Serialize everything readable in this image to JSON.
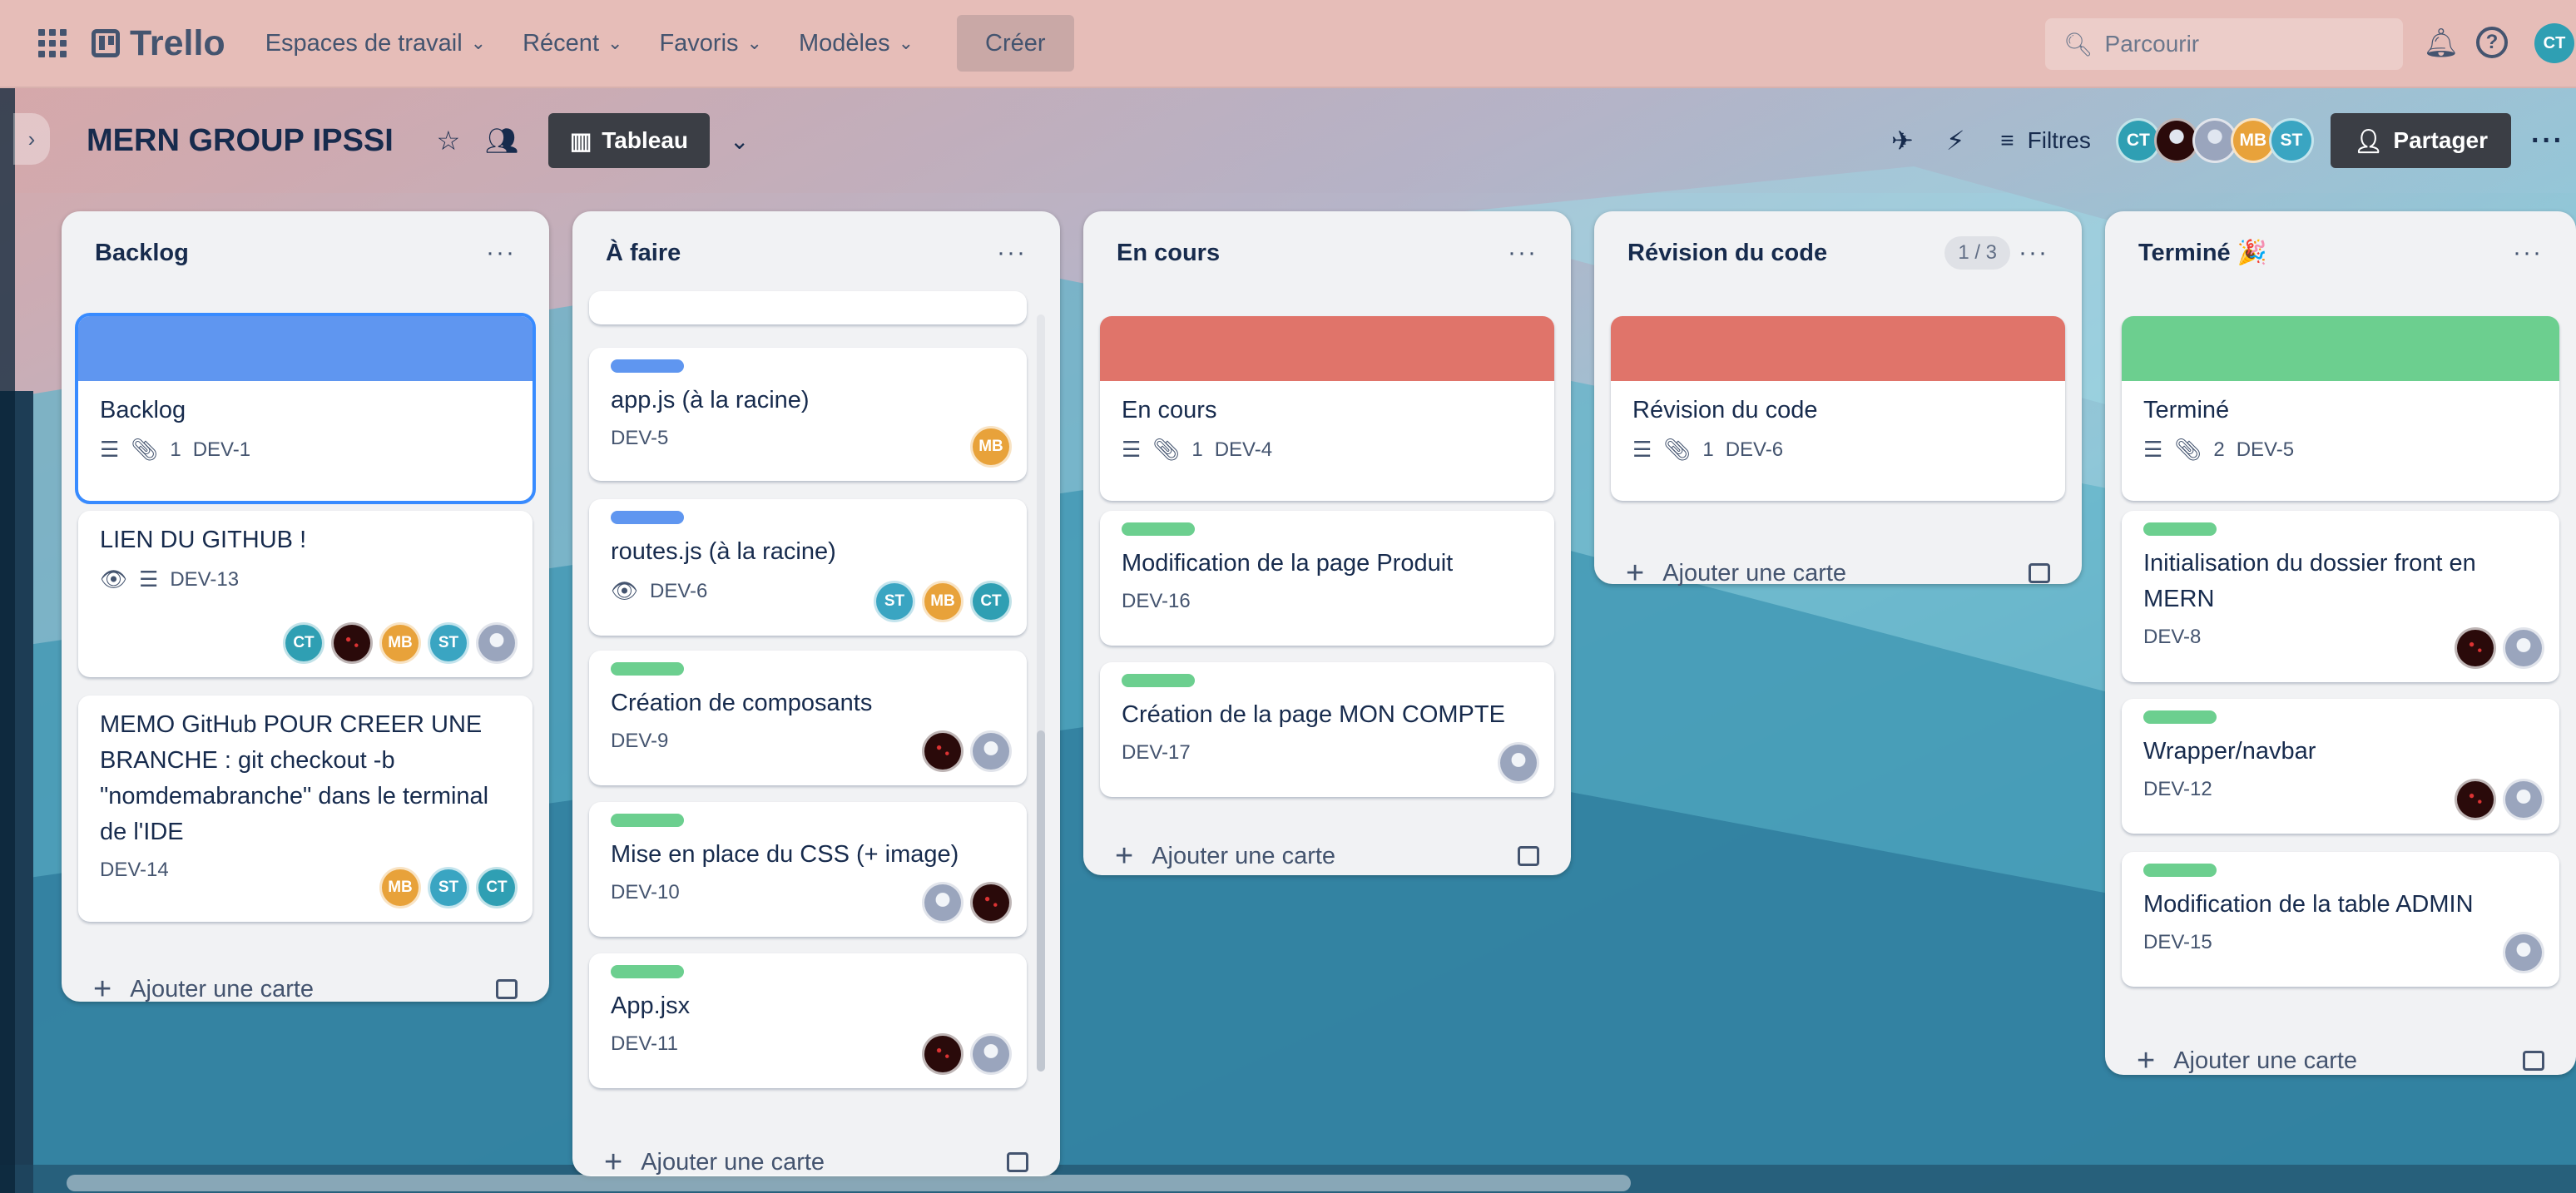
{
  "topbar": {
    "brand": "Trello",
    "workspaces": "Espaces de travail",
    "recent": "Récent",
    "favorites": "Favoris",
    "templates": "Modèles",
    "create": "Créer",
    "search_placeholder": "Parcourir",
    "user_initials": "CT"
  },
  "board": {
    "title": "MERN GROUP IPSSI",
    "view_label": "Tableau",
    "filters_label": "Filtres",
    "share_label": "Partager",
    "members": [
      {
        "initials": "CT",
        "color": "#2f9fb3"
      },
      {
        "initials": "",
        "color": "#2a0a0a"
      },
      {
        "initials": "",
        "color": "#9aa5bd"
      },
      {
        "initials": "MB",
        "color": "#e8a23a"
      },
      {
        "initials": "ST",
        "color": "#3aa5c2"
      }
    ]
  },
  "add_card_label": "Ajouter une carte",
  "lists": [
    {
      "title": "Backlog",
      "count": "",
      "cards": [
        {
          "cover": "#5f96f0",
          "title": "Backlog",
          "badges": [
            "desc",
            "attach"
          ],
          "attachments": "1",
          "id": "DEV-1",
          "members": []
        },
        {
          "title": "LIEN DU GITHUB !",
          "badges": [
            "watch",
            "desc"
          ],
          "id": "DEV-13",
          "members": [
            "CT",
            "dark",
            "MB",
            "ST",
            "photo"
          ]
        },
        {
          "title": "MEMO GitHub POUR CREER UNE BRANCHE : git checkout -b \"nomdemabranche\" dans le terminal de l'IDE",
          "badges": [],
          "id": "DEV-14",
          "members": [
            "MB",
            "ST",
            "CT"
          ]
        }
      ]
    },
    {
      "title": "À faire",
      "count": "",
      "cards": [
        {
          "label": "#5f96f0",
          "title": "app.js (à la racine)",
          "badges": [],
          "id": "DEV-5",
          "members": [
            "MB"
          ]
        },
        {
          "label": "#5f96f0",
          "title": "routes.js (à la racine)",
          "badges": [
            "watch"
          ],
          "id": "DEV-6",
          "members": [
            "ST",
            "MB",
            "CT"
          ]
        },
        {
          "label": "#6ccf8f",
          "title": "Création de composants",
          "badges": [],
          "id": "DEV-9",
          "members": [
            "dark",
            "photo"
          ]
        },
        {
          "label": "#6ccf8f",
          "title": "Mise en place du CSS (+ image)",
          "badges": [],
          "id": "DEV-10",
          "members": [
            "photo",
            "dark"
          ]
        },
        {
          "label": "#6ccf8f",
          "title": "App.jsx",
          "badges": [],
          "id": "DEV-11",
          "members": [
            "dark",
            "photo"
          ]
        }
      ]
    },
    {
      "title": "En cours",
      "count": "",
      "cards": [
        {
          "cover": "#e0746a",
          "title": "En cours",
          "badges": [
            "desc",
            "attach"
          ],
          "attachments": "1",
          "id": "DEV-4",
          "members": []
        },
        {
          "label": "#6ccf8f",
          "title": "Modification de la page Produit",
          "badges": [],
          "id": "DEV-16",
          "members": []
        },
        {
          "label": "#6ccf8f",
          "title": "Création de la page MON COMPTE",
          "badges": [],
          "id": "DEV-17",
          "members": [
            "photo"
          ]
        }
      ]
    },
    {
      "title": "Révision du code",
      "count": "1 / 3",
      "cards": [
        {
          "cover": "#e0746a",
          "title": "Révision du code",
          "badges": [
            "desc",
            "attach"
          ],
          "attachments": "1",
          "id": "DEV-6",
          "members": []
        }
      ]
    },
    {
      "title": "Terminé 🎉",
      "count": "",
      "cards": [
        {
          "cover": "#6ccf8f",
          "title": "Terminé",
          "badges": [
            "desc",
            "attach"
          ],
          "attachments": "2",
          "id": "DEV-5",
          "members": []
        },
        {
          "label": "#6ccf8f",
          "title": "Initialisation du dossier front en MERN",
          "badges": [],
          "id": "DEV-8",
          "members": [
            "dark",
            "photo"
          ]
        },
        {
          "label": "#6ccf8f",
          "title": "Wrapper/navbar",
          "badges": [],
          "id": "DEV-12",
          "members": [
            "dark",
            "photo"
          ]
        },
        {
          "label": "#6ccf8f",
          "title": "Modification de la table ADMIN",
          "badges": [],
          "id": "DEV-15",
          "members": [
            "photo"
          ]
        }
      ]
    }
  ]
}
